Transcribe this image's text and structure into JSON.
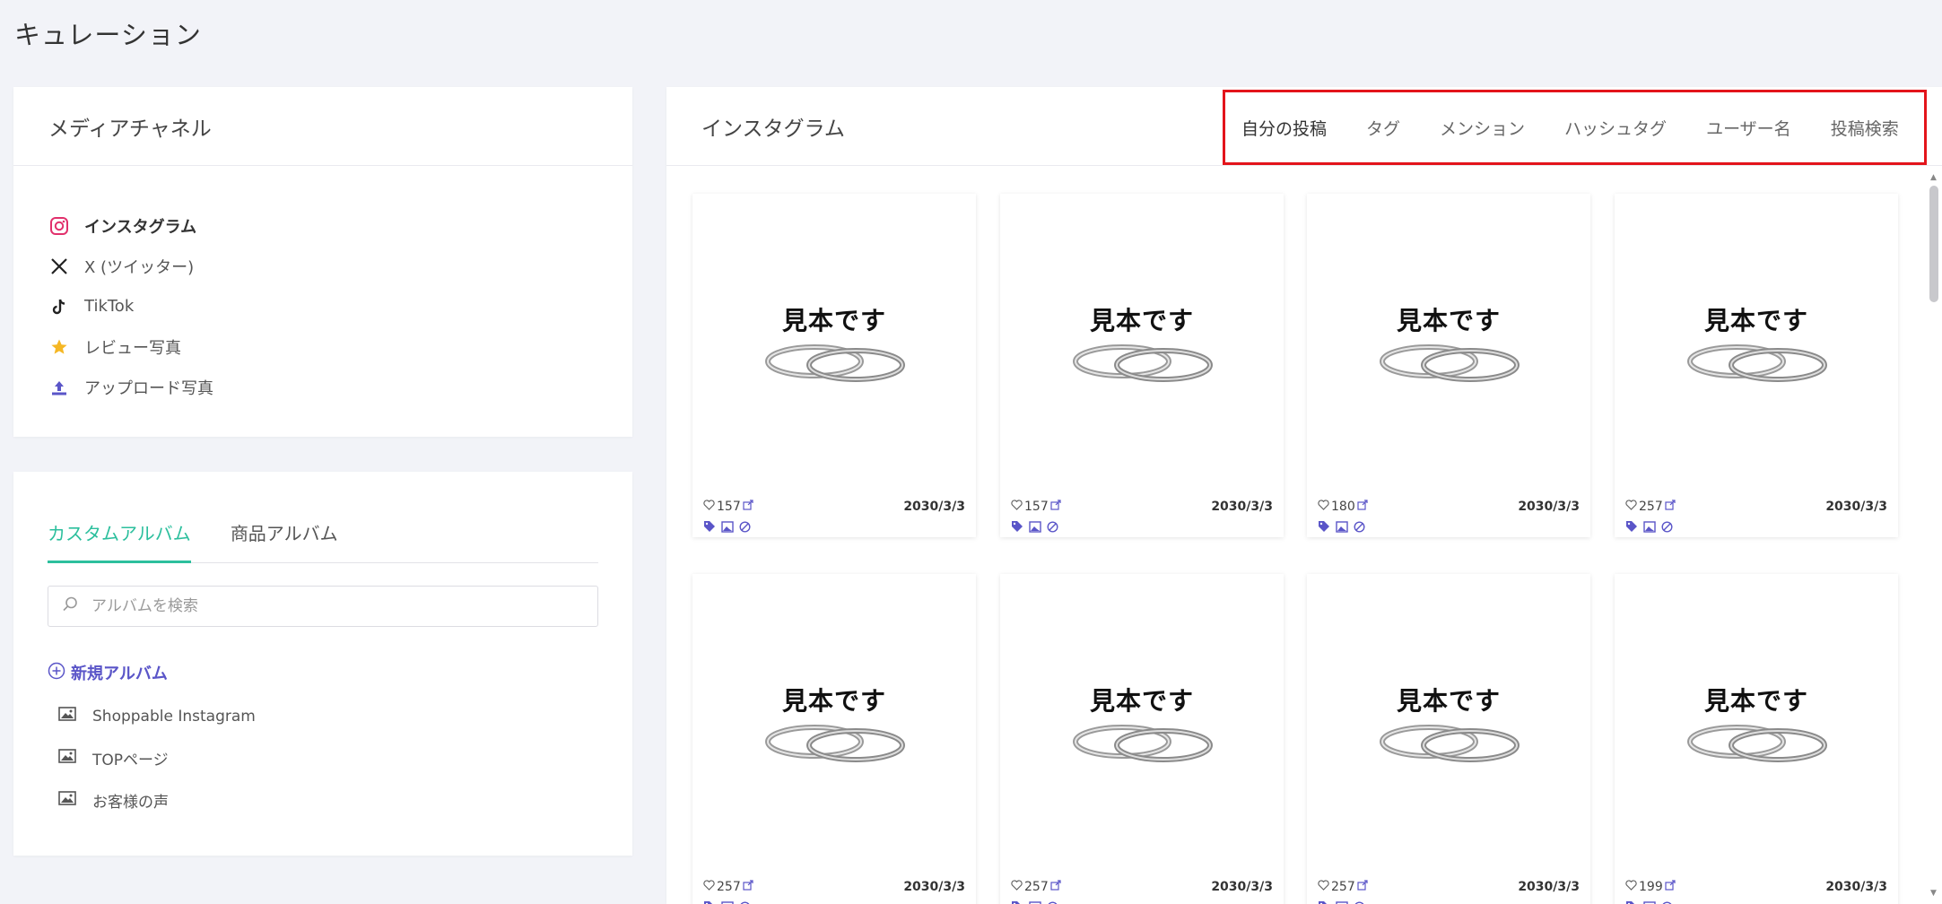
{
  "page": {
    "title": "キュレーション"
  },
  "media_channels": {
    "title": "メディアチャネル",
    "items": [
      {
        "label": "インスタグラム",
        "icon": "instagram-icon",
        "active": true
      },
      {
        "label": "X (ツイッター)",
        "icon": "x-icon",
        "active": false
      },
      {
        "label": "TikTok",
        "icon": "tiktok-icon",
        "active": false
      },
      {
        "label": "レビュー写真",
        "icon": "star-icon",
        "active": false
      },
      {
        "label": "アップロード写真",
        "icon": "upload-icon",
        "active": false
      }
    ]
  },
  "albums": {
    "tabs": [
      {
        "label": "カスタムアルバム",
        "active": true
      },
      {
        "label": "商品アルバム",
        "active": false
      }
    ],
    "search_placeholder": "アルバムを検索",
    "new_album_label": "新規アルバム",
    "items": [
      {
        "label": "Shoppable Instagram",
        "icon": "image-icon"
      },
      {
        "label": "TOPページ",
        "icon": "image-icon"
      },
      {
        "label": "お客様の声",
        "icon": "image-icon"
      }
    ]
  },
  "instagram": {
    "title": "インスタグラム",
    "filter_tabs": [
      {
        "label": "自分の投稿",
        "active": true
      },
      {
        "label": "タグ",
        "active": false
      },
      {
        "label": "メンション",
        "active": false
      },
      {
        "label": "ハッシュタグ",
        "active": false
      },
      {
        "label": "ユーザー名",
        "active": false
      },
      {
        "label": "投稿検索",
        "active": false
      }
    ],
    "posts": [
      {
        "image_text": "見本です",
        "likes": "157",
        "date": "2030/3/3"
      },
      {
        "image_text": "見本です",
        "likes": "157",
        "date": "2030/3/3"
      },
      {
        "image_text": "見本です",
        "likes": "180",
        "date": "2030/3/3"
      },
      {
        "image_text": "見本です",
        "likes": "257",
        "date": "2030/3/3"
      },
      {
        "image_text": "見本です",
        "likes": "257",
        "date": "2030/3/3"
      },
      {
        "image_text": "見本です",
        "likes": "257",
        "date": "2030/3/3"
      },
      {
        "image_text": "見本です",
        "likes": "257",
        "date": "2030/3/3"
      },
      {
        "image_text": "見本です",
        "likes": "199",
        "date": "2030/3/3"
      }
    ]
  },
  "colors": {
    "accent_green": "#2cbf9d",
    "accent_purple": "#5a55c8",
    "highlight_red": "#e3141b",
    "instagram_pink": "#e1306c",
    "star_yellow": "#f5b724"
  }
}
